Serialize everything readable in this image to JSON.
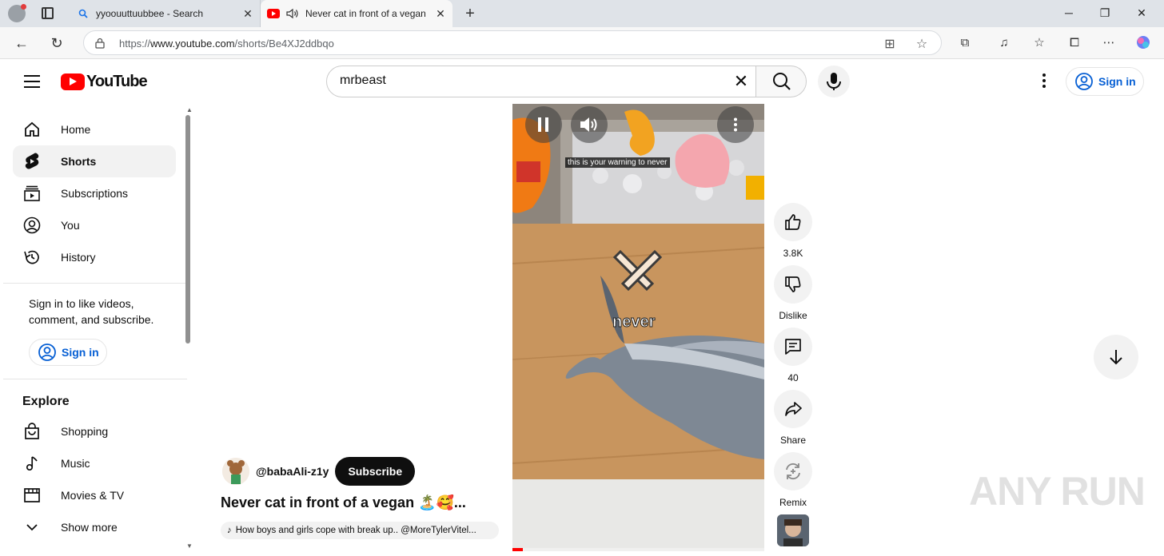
{
  "browser": {
    "tabs": [
      {
        "title": "yyoouuttuubbee - Search",
        "active": false
      },
      {
        "title": "Never cat in front of a vegan",
        "active": true
      }
    ],
    "url_prefix": "https://",
    "url_host": "www.youtube.com",
    "url_path": "/shorts/Be4XJ2ddbqo"
  },
  "masthead": {
    "logo_text": "YouTube",
    "search_value": "mrbeast",
    "signin_label": "Sign in"
  },
  "sidebar": {
    "items": [
      {
        "label": "Home",
        "icon": "home-icon"
      },
      {
        "label": "Shorts",
        "icon": "shorts-icon",
        "active": true
      },
      {
        "label": "Subscriptions",
        "icon": "subscriptions-icon"
      },
      {
        "label": "You",
        "icon": "you-icon"
      },
      {
        "label": "History",
        "icon": "history-icon"
      }
    ],
    "signin_prompt": "Sign in to like videos, comment, and subscribe.",
    "signin_label": "Sign in",
    "explore_heading": "Explore",
    "explore_items": [
      {
        "label": "Shopping",
        "icon": "shopping-icon"
      },
      {
        "label": "Music",
        "icon": "music-icon"
      },
      {
        "label": "Movies & TV",
        "icon": "movies-icon"
      },
      {
        "label": "Show more",
        "icon": "chevron-down-icon"
      }
    ]
  },
  "player": {
    "caption": "this is your warning to never",
    "overlay_word": "never",
    "progress": 0.04
  },
  "video": {
    "channel": "@babaAli-z1y",
    "subscribe_label": "Subscribe",
    "title": "Never cat in front of a vegan 🏝️🥰...",
    "music": "How boys and girls cope with break up.. @MoreTylerVitel..."
  },
  "actions": {
    "likes": "3.8K",
    "dislike_label": "Dislike",
    "comments": "40",
    "share_label": "Share",
    "remix_label": "Remix"
  },
  "watermark": "ANY RUN",
  "colors": {
    "brand_red": "#ff0000",
    "link_blue": "#065fd4"
  }
}
